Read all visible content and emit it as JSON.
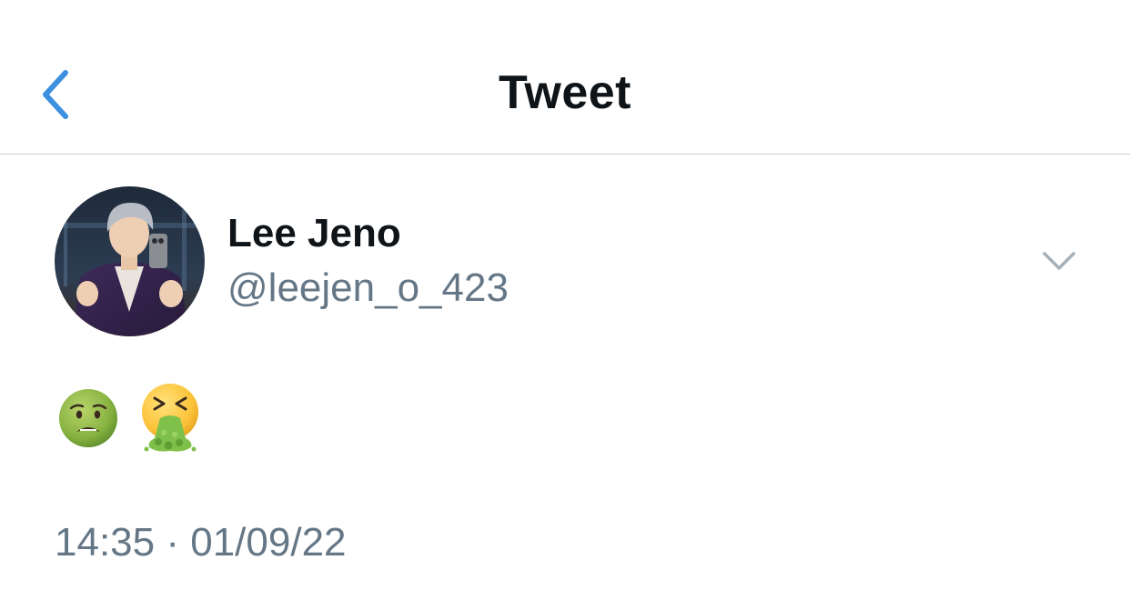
{
  "header": {
    "title": "Tweet",
    "back_icon": "chevron-left-icon",
    "accent_color": "#3d8fe0"
  },
  "author": {
    "display_name": "Lee Jeno",
    "handle": "@leejen_o_423",
    "menu_icon": "chevron-down-icon"
  },
  "tweet": {
    "emojis": [
      "nauseated-face-emoji",
      "face-vomiting-emoji"
    ],
    "time": "14:35",
    "separator": "·",
    "date": "01/09/22"
  },
  "colors": {
    "text_primary": "#0f1419",
    "text_secondary": "#657786",
    "divider": "#c9ccd0",
    "caret": "#a6b0b9"
  }
}
